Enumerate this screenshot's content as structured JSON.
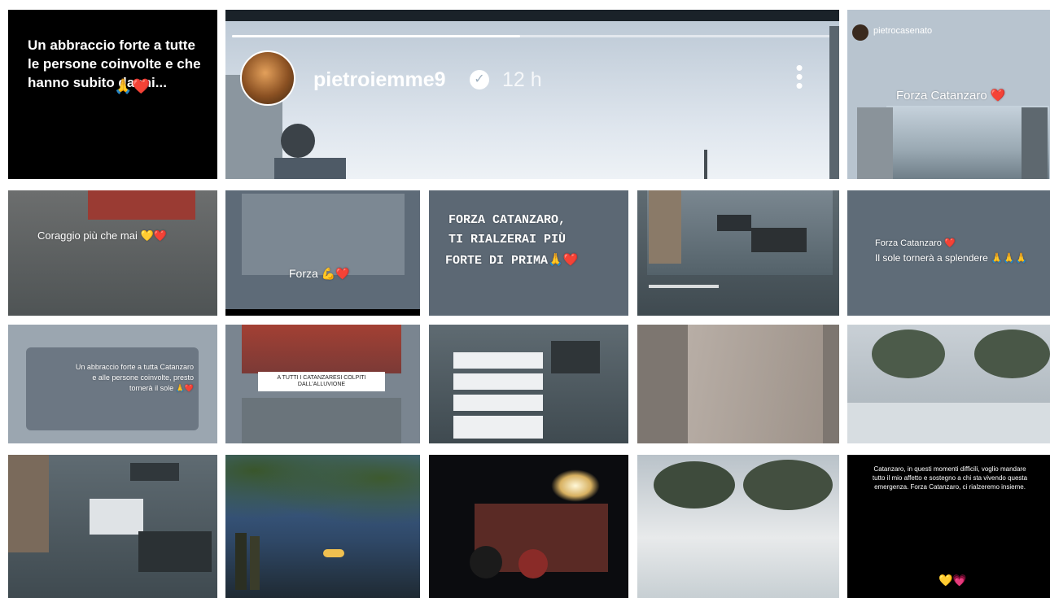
{
  "story_header": {
    "username": "pietroiemme9",
    "time": "12 h",
    "verified_icon": "verified-check-icon",
    "menu_icon": "more-vertical-icon"
  },
  "tiles": {
    "t1_text": "Un abbraccio forte a tutte le persone coinvolte e che hanno subito danni...",
    "t1_emoji": "🙏❤️",
    "t3_header": "pietrocasenato",
    "t3_text": "Forza Catanzaro ❤️",
    "t4_text": "Coraggio più che mai 💛❤️",
    "t5_text": "Forza 💪❤️",
    "t6_line1": "FORZA CATANZARO,",
    "t6_line2": "TI RIALZERAI PIÙ",
    "t6_line3": "FORTE DI PRIMA🙏❤️",
    "t8_line1": "Forza Catanzaro ❤️",
    "t8_line2": "Il sole tornerà a splendere 🙏🙏🙏",
    "t9_text": "Un abbraccio forte a tutta Catanzaro e alle persone coinvolte, presto tornerà il sole 🙏❤️",
    "t10_caption": "A TUTTI I CATANZARESI COLPITI DALL'ALLUVIONE",
    "t19_text": "Catanzaro, in questi momenti difficili, voglio mandare tutto il mio affetto e sostegno a chi sta vivendo questa emergenza. Forza Catanzaro, ci rialzeremo insieme.",
    "t19_emoji": "💛💗"
  }
}
